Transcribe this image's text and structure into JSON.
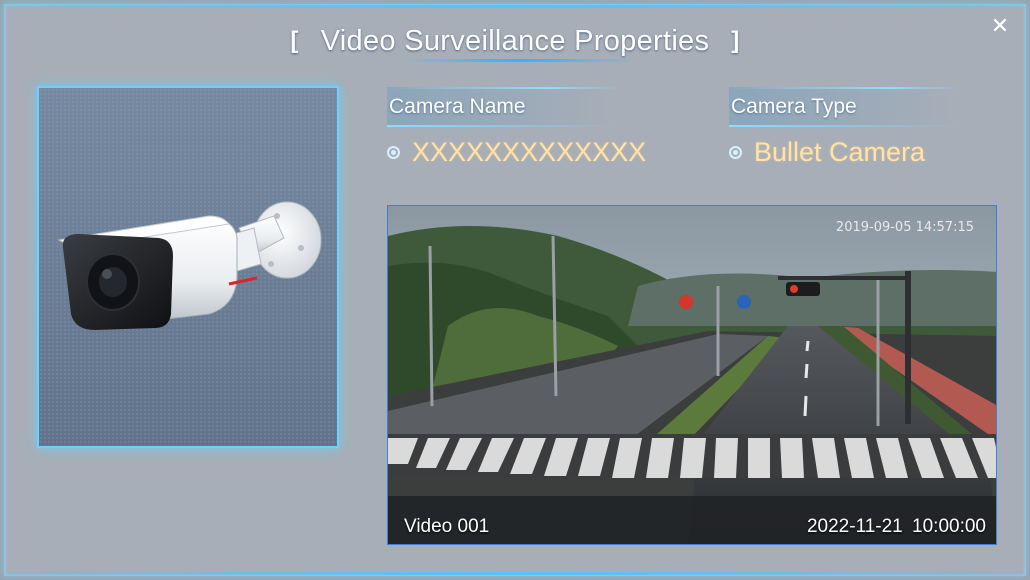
{
  "dialog": {
    "title": "Video Surveillance Properties",
    "bracket_left": "[",
    "bracket_right": "]",
    "close_icon": "close-icon",
    "close_glyph": "✕"
  },
  "camera_image": {
    "icon": "bullet-camera-icon"
  },
  "fields": {
    "camera_name": {
      "label": "Camera Name",
      "value": "XXXXXXXXXXXXX"
    },
    "camera_type": {
      "label": "Camera Type",
      "value": "Bullet Camera"
    }
  },
  "video": {
    "label": "Video 001",
    "timestamp": "2022-11-21  10:00:00",
    "osd_timestamp": "2019-09-05 14:57:15"
  },
  "colors": {
    "accent": "#6fd0ff",
    "value_text": "#ffe3a8",
    "dialog_bg": "#a7aeb8"
  }
}
